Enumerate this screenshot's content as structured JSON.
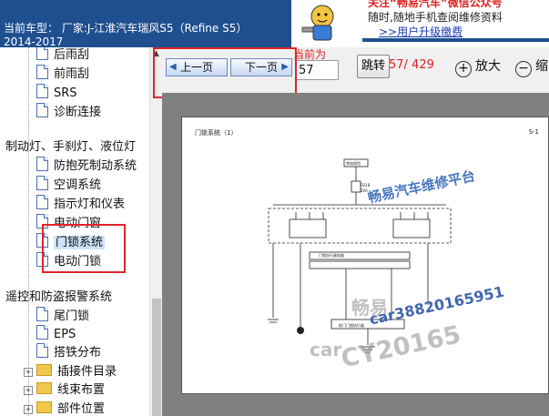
{
  "header": {
    "car_model": "当前车型： 厂家:J-江淮汽车瑞风S5（Refine S5）",
    "year": "2014-2017"
  },
  "promo": {
    "line1": "关注“畅易汽车”微信公众号",
    "line2": "随时,随地手机查阅维修资料",
    "link": ">>用户升级缴费"
  },
  "sidebar": {
    "items": [
      {
        "label": "后雨刮",
        "type": "doc"
      },
      {
        "label": "前雨刮",
        "type": "doc"
      },
      {
        "label": "SRS",
        "type": "doc"
      },
      {
        "label": "诊断连接",
        "type": "doc"
      },
      {
        "label": "制动灯、手刹灯、液位灯",
        "type": "group"
      },
      {
        "label": "防抱死制动系统",
        "type": "doc"
      },
      {
        "label": "空调系统",
        "type": "doc"
      },
      {
        "label": "指示灯和仪表",
        "type": "doc"
      },
      {
        "label": "电动门窗",
        "type": "doc"
      },
      {
        "label": "门锁系统",
        "type": "doc",
        "selected": true
      },
      {
        "label": "电动门锁",
        "type": "doc"
      },
      {
        "label": "遥控和防盗报警系统",
        "type": "group"
      },
      {
        "label": "尾门锁",
        "type": "doc"
      },
      {
        "label": "EPS",
        "type": "doc"
      },
      {
        "label": "搭铁分布",
        "type": "doc"
      },
      {
        "label": "插接件目录",
        "type": "folder"
      },
      {
        "label": "线束布置",
        "type": "folder"
      },
      {
        "label": "部件位置",
        "type": "folder"
      }
    ]
  },
  "toolbar": {
    "prev_label": "上一页",
    "next_label": "下一页",
    "page_label": "当前为",
    "page_value": "57",
    "jump_label": "跳转",
    "page_count": "57/ 429",
    "zoom_in_label": "放大",
    "zoom_out_label": "缩"
  },
  "document": {
    "title": "门锁系统（1）",
    "page_code": "S-1",
    "watermark_main": "畅易汽车维修平台",
    "watermark_sub": "畅易",
    "watermark_id": "car38820165951",
    "watermark_car": "car",
    "watermark_cy": "CY20165"
  },
  "colors": {
    "header_bg": "#1f4f8f",
    "highlight_red": "#e0242a",
    "selected_bg": "#cde3f8",
    "viewer_bg": "#808080"
  }
}
